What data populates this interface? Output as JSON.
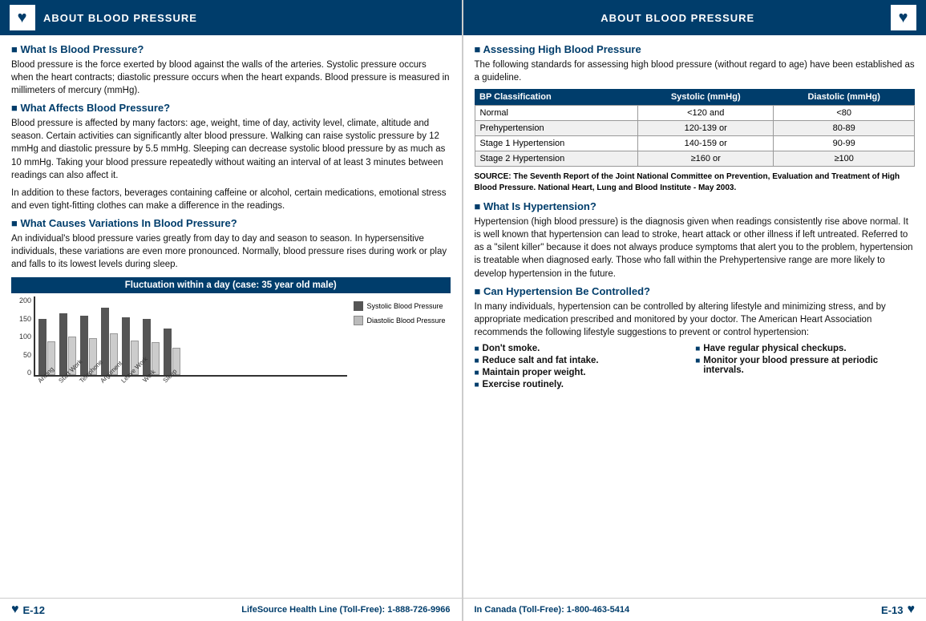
{
  "left": {
    "header_title": "ABOUT BLOOD PRESSURE",
    "sections": [
      {
        "id": "what-is-bp",
        "title": "What Is Blood Pressure?",
        "body": "Blood pressure is the force exerted by blood against the walls of the arteries. Systolic pressure occurs when the heart contracts; diastolic pressure occurs when the heart expands. Blood pressure is measured in millimeters of mercury (mmHg)."
      },
      {
        "id": "what-affects-bp",
        "title": "What Affects Blood Pressure?",
        "body": "Blood pressure is affected by many factors: age, weight, time of day, activity level, climate, altitude and season. Certain activities can significantly alter blood pressure. Walking can raise systolic pressure by 12 mmHg and diastolic pressure by 5.5 mmHg. Sleeping can decrease systolic blood pressure by as much as 10 mmHg. Taking your blood pressure repeatedly without waiting an interval of at least 3 minutes between readings can also affect it.\n\nIn addition to these factors, beverages containing caffeine or alcohol, certain medications, emotional stress and even tight-fitting clothes can make a difference in the readings."
      },
      {
        "id": "variations-bp",
        "title": "What Causes Variations In Blood Pressure?",
        "body": "An individual's blood pressure varies greatly from day to day and season to season. In hypersensitive individuals, these variations are even more pronounced. Normally, blood pressure rises during work or play and falls to its lowest levels during sleep."
      }
    ],
    "chart": {
      "title": "Fluctuation within a day (case: 35 year old male)",
      "y_labels": [
        "200",
        "150",
        "100",
        "50",
        "0"
      ],
      "bars": [
        {
          "label": "Arising",
          "systolic": 145,
          "diastolic": 88
        },
        {
          "label": "Start Work",
          "systolic": 160,
          "diastolic": 100
        },
        {
          "label": "Telephone",
          "systolic": 155,
          "diastolic": 95
        },
        {
          "label": "Argument",
          "systolic": 175,
          "diastolic": 108
        },
        {
          "label": "Leave Work",
          "systolic": 150,
          "diastolic": 90
        },
        {
          "label": "Work",
          "systolic": 145,
          "diastolic": 85
        },
        {
          "label": "Sleep",
          "systolic": 120,
          "diastolic": 70
        }
      ],
      "max_val": 200,
      "legend": [
        {
          "label": "Systolic Blood Pressure",
          "color": "#555"
        },
        {
          "label": "Diastolic Blood Pressure",
          "color": "#bbb"
        }
      ]
    },
    "footer_page": "E-12",
    "footer_phone": "LifeSource Health Line (Toll-Free): 1-888-726-9966"
  },
  "right": {
    "header_title": "ABOUT BLOOD PRESSURE",
    "sections": [
      {
        "id": "assessing-bp",
        "title": "Assessing High Blood Pressure",
        "intro": "The following standards for assessing high blood pressure (without regard to age) have been established as a guideline."
      },
      {
        "id": "what-is-hypertension",
        "title": "What Is Hypertension?",
        "body": "Hypertension (high blood pressure) is the diagnosis given when readings consistently rise above normal. It is well known that hypertension can lead to stroke, heart attack or other illness if left untreated. Referred to as a \"silent killer\" because it does not always produce symptoms that alert you to the problem, hypertension is treatable when diagnosed early. Those who fall within the Prehypertensive range are more likely to develop hypertension in the future."
      },
      {
        "id": "can-be-controlled",
        "title": "Can Hypertension Be Controlled?",
        "body": "In many individuals, hypertension can be controlled by altering lifestyle and minimizing stress, and by appropriate medication prescribed and monitored by your doctor. The American Heart Association recommends the following lifestyle suggestions to prevent or control hypertension:"
      }
    ],
    "bp_table": {
      "headers": [
        "BP Classification",
        "Systolic (mmHg)",
        "Diastolic (mmHg)"
      ],
      "rows": [
        [
          "Normal",
          "<120  and",
          "<80"
        ],
        [
          "Prehypertension",
          "120-139  or",
          "80-89"
        ],
        [
          "Stage 1 Hypertension",
          "140-159  or",
          "90-99"
        ],
        [
          "Stage 2 Hypertension",
          "≥160  or",
          "≥100"
        ]
      ]
    },
    "source": "SOURCE: The Seventh Report of the Joint National Committee on Prevention, Evaluation and Treatment of High Blood Pressure. National Heart, Lung and Blood Institute - May 2003.",
    "bullets_col1": [
      "Don't smoke.",
      "Reduce salt and fat intake.",
      "Maintain proper weight.",
      "Exercise routinely."
    ],
    "bullets_col2": [
      "Have regular physical checkups.",
      "Monitor your blood pressure at periodic intervals."
    ],
    "footer_page": "E-13",
    "footer_phone": "In Canada (Toll-Free): 1-800-463-5414"
  }
}
